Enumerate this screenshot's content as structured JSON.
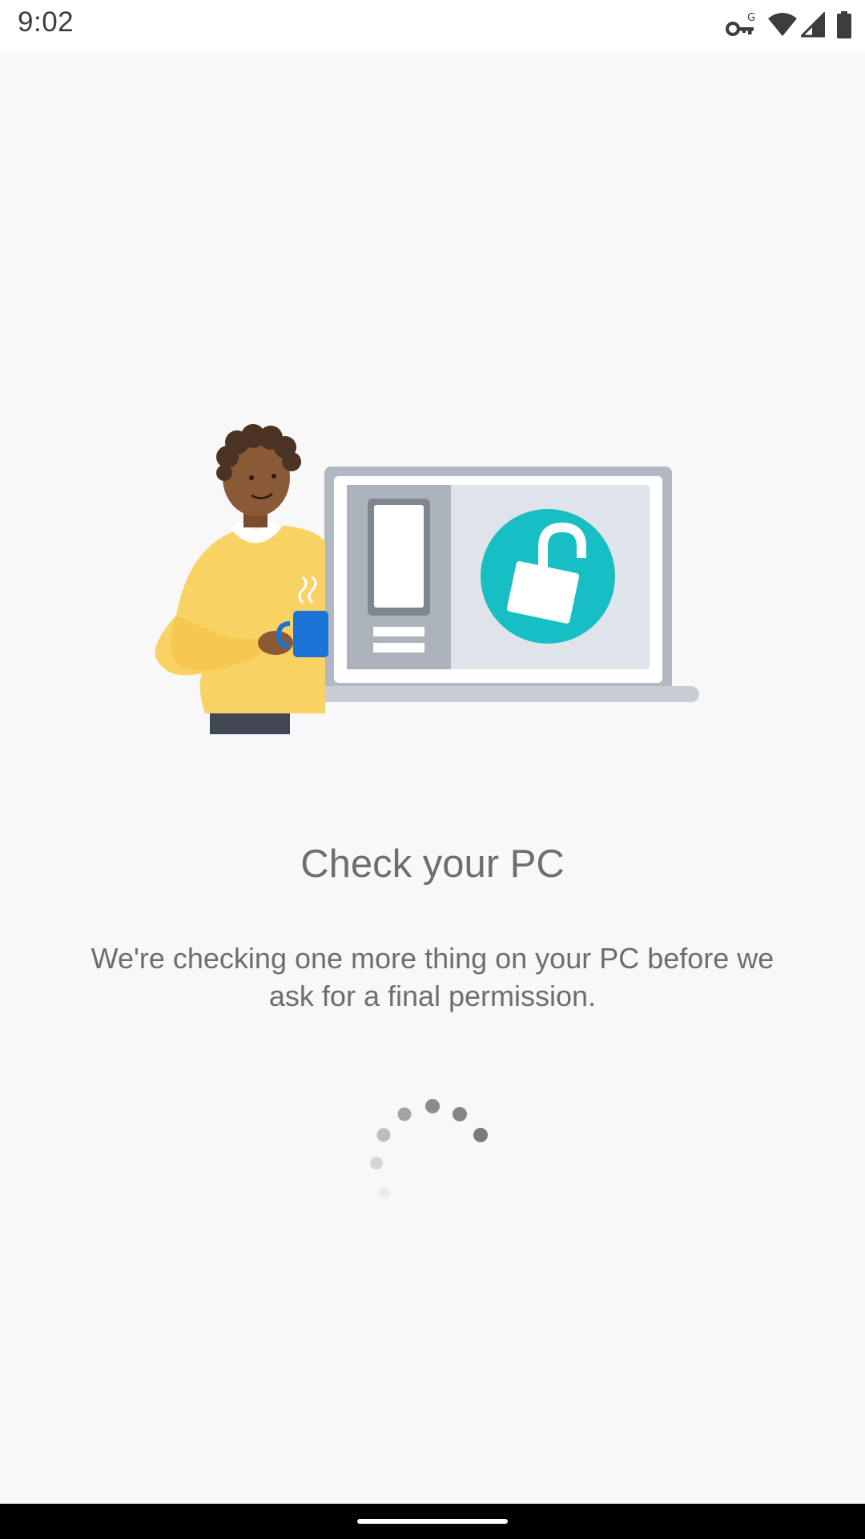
{
  "status_bar": {
    "time": "9:02",
    "icons": [
      "vpn-key-icon",
      "wifi-icon",
      "signal-icon",
      "battery-icon"
    ]
  },
  "illustration": {
    "description_icons": [
      "person-icon",
      "coffee-mug-icon",
      "laptop-icon",
      "phone-icon",
      "unlocked-padlock-icon"
    ],
    "colors": {
      "sweater": "#f9d264",
      "skin": "#8a5a37",
      "hair": "#4a3325",
      "mug": "#1a74d6",
      "laptop_frame": "#b2b8c2",
      "screen": "#dfe3ea",
      "lock_circle": "#17bfc4"
    }
  },
  "content": {
    "title": "Check your PC",
    "message": "We're checking one more thing on your PC before we ask for a final permission."
  },
  "spinner": {
    "state": "loading"
  }
}
